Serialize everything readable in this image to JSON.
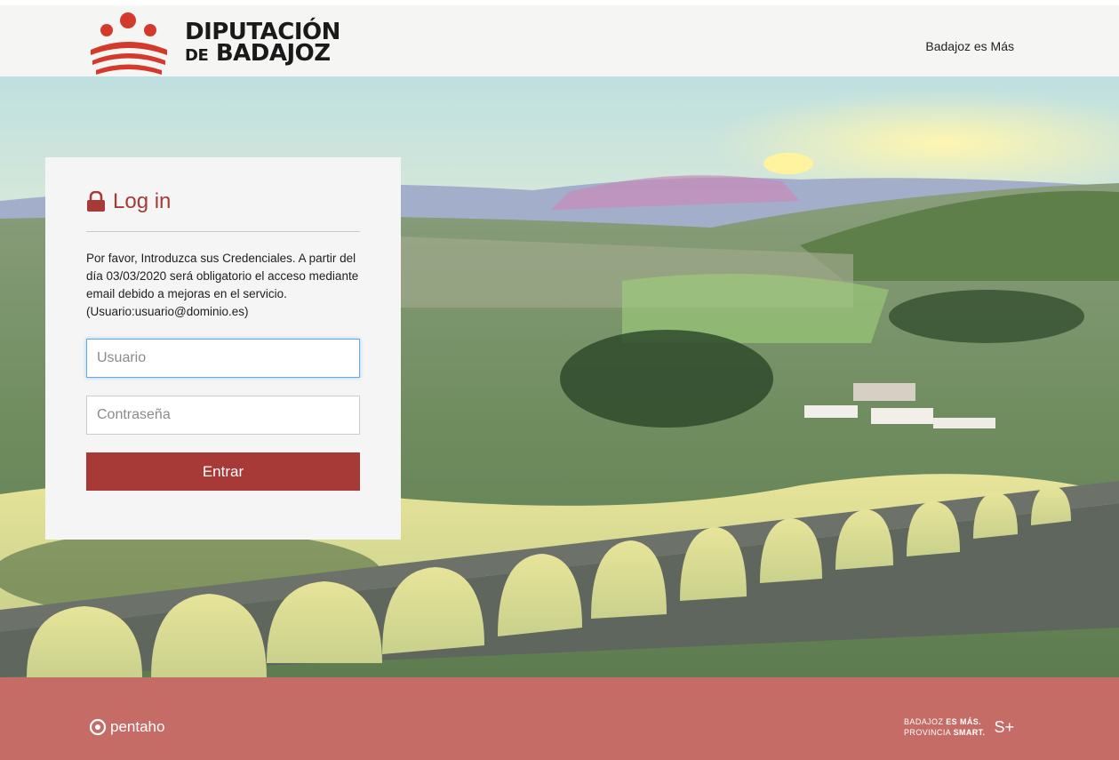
{
  "header": {
    "logo_line1": "DIPUTACIÓN",
    "logo_line2_small": "DE",
    "logo_line2": "BADAJOZ",
    "link": "Badajoz es Más"
  },
  "login": {
    "title": "Log in",
    "description": "Por favor, Introduzca sus Credenciales. A partir del día 03/03/2020 será obligatorio el acceso mediante email debido a mejoras en el servicio. (Usuario:usuario@dominio.es)",
    "username_placeholder": "Usuario",
    "password_placeholder": "Contraseña",
    "submit_label": "Entrar"
  },
  "footer": {
    "pentaho_label": "pentaho",
    "smart_line1_a": "BADAJOZ",
    "smart_line1_b": "ES MÁS.",
    "smart_line2_a": "PROVINCIA",
    "smart_line2_b": "SMART.",
    "smart_mark": "S+"
  },
  "colors": {
    "accent": "#a73a36",
    "focus_border": "#66a9e3",
    "footer_overlay": "#b9453f"
  }
}
